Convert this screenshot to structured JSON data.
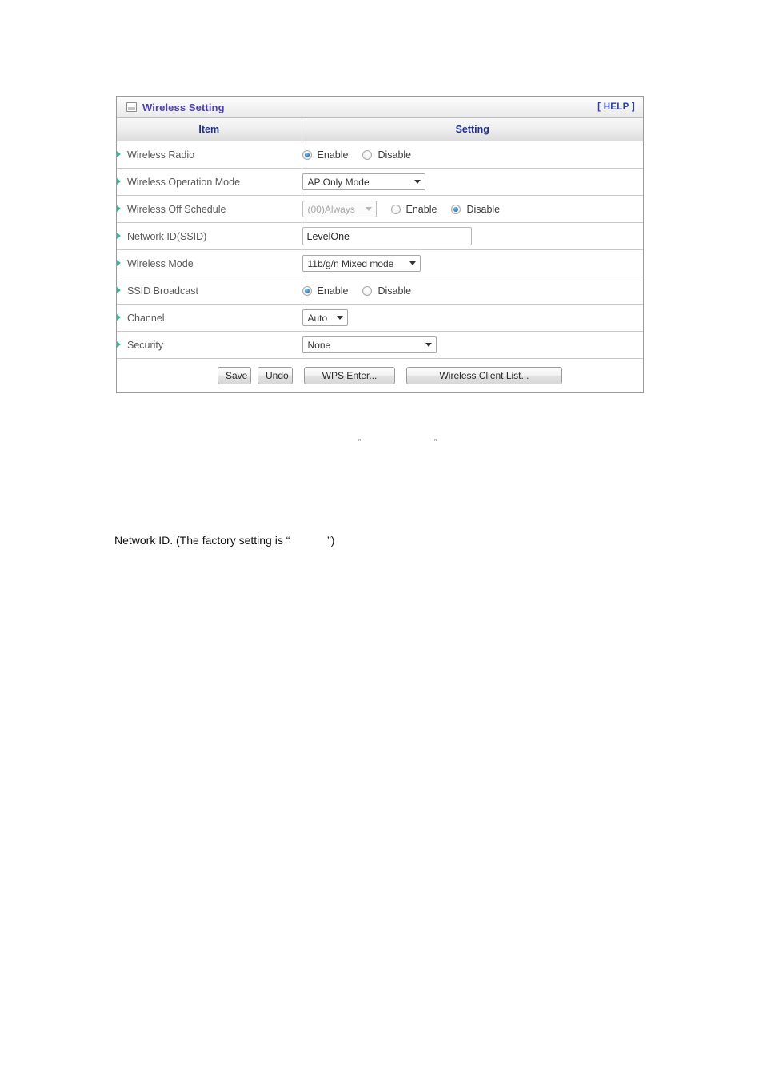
{
  "panel": {
    "title": "Wireless Setting",
    "help_label": "[ HELP ]",
    "icon": "window-icon",
    "title_color": "#4c3fc0",
    "help_color": "#2b3fb5"
  },
  "table": {
    "headers": {
      "item": "Item",
      "setting": "Setting"
    },
    "rows": [
      {
        "item": "Wireless Radio",
        "control": "radio",
        "options": [
          "Enable",
          "Disable"
        ],
        "selected": "Enable"
      },
      {
        "item": "Wireless Operation Mode",
        "control": "select",
        "value": "AP Only Mode"
      },
      {
        "item": "Wireless Off Schedule",
        "control": "select-radio",
        "select_value": "(00)Always",
        "select_disabled": true,
        "options": [
          "Enable",
          "Disable"
        ],
        "selected": "Disable"
      },
      {
        "item": "Network ID(SSID)",
        "control": "text",
        "value": "LevelOne"
      },
      {
        "item": "Wireless Mode",
        "control": "select",
        "value": "11b/g/n Mixed mode"
      },
      {
        "item": "SSID Broadcast",
        "control": "radio",
        "options": [
          "Enable",
          "Disable"
        ],
        "selected": "Enable"
      },
      {
        "item": "Channel",
        "control": "select",
        "value": "Auto"
      },
      {
        "item": "Security",
        "control": "select",
        "value": "None"
      }
    ],
    "buttons": {
      "save": "Save",
      "undo": "Undo",
      "wps": "WPS Enter...",
      "client_list": "Wireless Client List..."
    }
  },
  "body_text": {
    "quote_line_left": "”",
    "quote_line_right": "”",
    "network_id_note": "Network ID. (The factory setting is “            ”)"
  }
}
